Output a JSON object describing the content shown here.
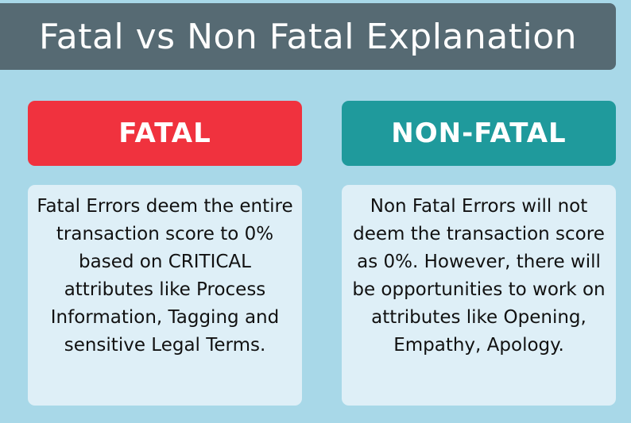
{
  "title": "Fatal vs Non Fatal Explanation",
  "columns": [
    {
      "heading": "FATAL",
      "body": "Fatal Errors deem the entire transaction score to 0% based on CRITICAL attributes like Process Information, Tagging and sensitive Legal Terms.",
      "heading_color": "#f0323e"
    },
    {
      "heading": "NON-FATAL",
      "body": "Non Fatal Errors will not deem the transaction score as 0%. However, there will be opportunities to work on attributes like Opening, Empathy, Apology.",
      "heading_color": "#1f9a9c"
    }
  ],
  "colors": {
    "background": "#a8d8e8",
    "title_bar": "#566a73",
    "body_box": "#deeff7"
  }
}
